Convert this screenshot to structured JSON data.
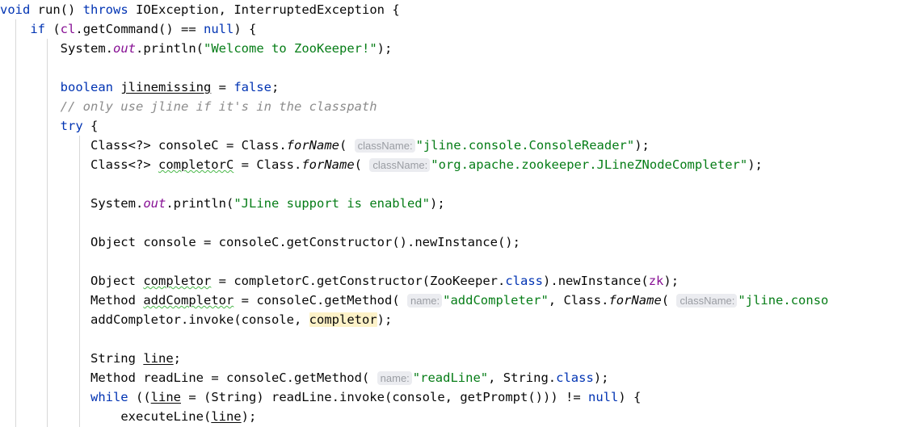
{
  "editor": {
    "language": "java",
    "font_size_px": 15.5,
    "line_height_px": 24,
    "background": "#ffffff",
    "indent_guide_color": "#d8d8d8",
    "indent_guide_x": [
      19,
      58,
      98
    ],
    "colors": {
      "keyword": "#0033b3",
      "string": "#067d17",
      "comment": "#8c8c8c",
      "field": "#871094",
      "plain": "#080808",
      "param_hint_bg": "#ebecf0",
      "param_hint_fg": "#9a9da3",
      "search_match_bg": "#fdf2c8",
      "typo_squiggle": "#4ab84a"
    },
    "param_hints": {
      "class_name": "className:",
      "name": "name:"
    },
    "lines": [
      {
        "id": 1,
        "text": "void run() throws IOException, InterruptedException {"
      },
      {
        "id": 2,
        "text": "    if (cl.getCommand() == null) {"
      },
      {
        "id": 3,
        "text": "        System.out.println(\"Welcome to ZooKeeper!\");"
      },
      {
        "id": 4,
        "text": ""
      },
      {
        "id": 5,
        "text": "        boolean jlinemissing = false;"
      },
      {
        "id": 6,
        "text": "        // only use jline if it's in the classpath"
      },
      {
        "id": 7,
        "text": "        try {"
      },
      {
        "id": 8,
        "text": "            Class<?> consoleC = Class.forName( className: \"jline.console.ConsoleReader\");"
      },
      {
        "id": 9,
        "text": "            Class<?> completorC = Class.forName( className: \"org.apache.zookeeper.JLineZNodeCompleter\");"
      },
      {
        "id": 10,
        "text": ""
      },
      {
        "id": 11,
        "text": "            System.out.println(\"JLine support is enabled\");"
      },
      {
        "id": 12,
        "text": ""
      },
      {
        "id": 13,
        "text": "            Object console = consoleC.getConstructor().newInstance();"
      },
      {
        "id": 14,
        "text": ""
      },
      {
        "id": 15,
        "text": "            Object completor = completorC.getConstructor(ZooKeeper.class).newInstance(zk);"
      },
      {
        "id": 16,
        "text": "            Method addCompletor = consoleC.getMethod( name: \"addCompleter\", Class.forName( className: \"jline.conso"
      },
      {
        "id": 17,
        "text": "            addCompletor.invoke(console, completor);"
      },
      {
        "id": 18,
        "text": ""
      },
      {
        "id": 19,
        "text": "            String line;"
      },
      {
        "id": 20,
        "text": "            Method readLine = consoleC.getMethod( name: \"readLine\", String.class);"
      },
      {
        "id": 21,
        "text": "            while ((line = (String) readLine.invoke(console, getPrompt())) != null) {"
      },
      {
        "id": 22,
        "text": "                executeLine(line);"
      }
    ],
    "tokens": {
      "void": "void",
      "run": "run",
      "throws": "throws",
      "ioexception": "IOException",
      "interruptedexception": "InterruptedException",
      "if": "if",
      "cl": "cl",
      "getCommand": "getCommand",
      "null": "null",
      "System": "System",
      "out": "out",
      "println": "println",
      "welcome_str": "\"Welcome to ZooKeeper!\"",
      "boolean": "boolean",
      "jlinemissing": "jlinemissing",
      "false": "false",
      "comment_jline": "// only use jline if it's in the classpath",
      "try": "try",
      "Class": "Class",
      "consoleC": "consoleC",
      "completorC": "completorC",
      "forName": "forName",
      "console_reader_str": "\"jline.console.ConsoleReader\"",
      "znode_completer_str": "\"org.apache.zookeeper.JLineZNodeCompleter\"",
      "jline_support_str": "\"JLine support is enabled\"",
      "Object": "Object",
      "console": "console",
      "getConstructor": "getConstructor",
      "newInstance": "newInstance",
      "completor": "completor",
      "ZooKeeper": "ZooKeeper",
      "class": "class",
      "zk": "zk",
      "Method": "Method",
      "addCompletor": "addCompletor",
      "getMethod": "getMethod",
      "addCompleter_str": "\"addCompleter\"",
      "jline_conso_trunc": "\"jline.conso",
      "invoke": "invoke",
      "String": "String",
      "line": "line",
      "readLine": "readLine",
      "readLine_str": "\"readLine\"",
      "while": "while",
      "getPrompt": "getPrompt",
      "executeLine": "executeLine"
    }
  }
}
